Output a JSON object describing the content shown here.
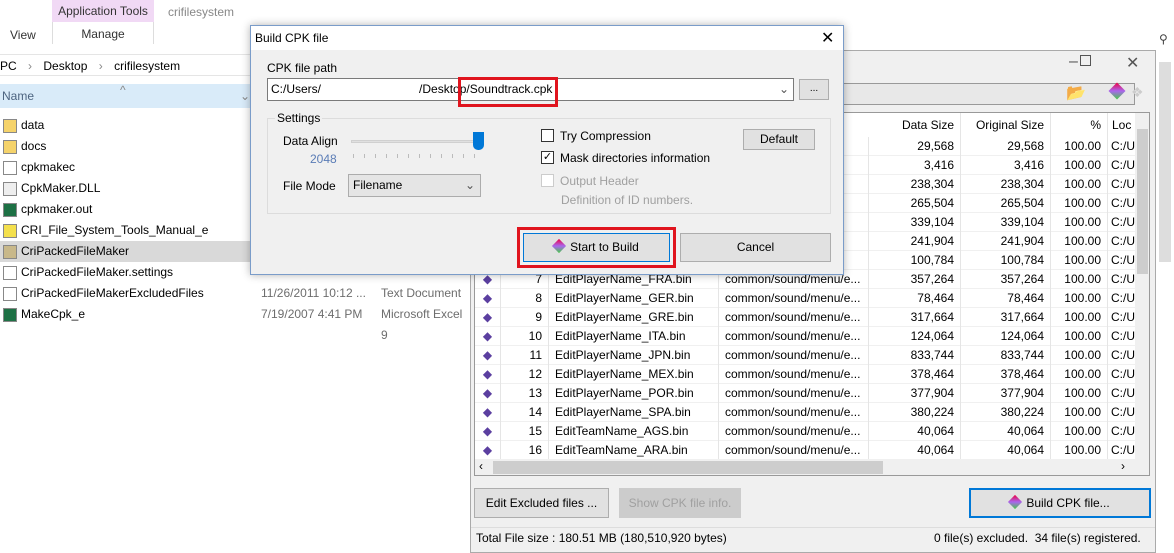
{
  "explorer": {
    "ribbon": {
      "view": "View",
      "application_tools": "Application Tools",
      "manage": "Manage",
      "title": "crifilesystem"
    },
    "breadcrumb": [
      "PC",
      "Desktop",
      "crifilesystem"
    ],
    "column_name": "Name",
    "files": [
      {
        "name": "data",
        "icon": "folder-icon",
        "date": "",
        "type": ""
      },
      {
        "name": "docs",
        "icon": "folder-icon",
        "date": "",
        "type": ""
      },
      {
        "name": "cpkmakec",
        "icon": "console-app-icon",
        "date": "",
        "type": ""
      },
      {
        "name": "CpkMaker.DLL",
        "icon": "dll-icon",
        "date": "",
        "type": ""
      },
      {
        "name": "cpkmaker.out",
        "icon": "excel-icon",
        "date": "",
        "type": ""
      },
      {
        "name": "CRI_File_System_Tools_Manual_e",
        "icon": "help-file-icon",
        "date": "",
        "type": ""
      },
      {
        "name": "CriPackedFileMaker",
        "icon": "app-icon",
        "date": "",
        "type": "",
        "selected": true
      },
      {
        "name": "CriPackedFileMaker.settings",
        "icon": "file-icon",
        "date": "",
        "type": ""
      },
      {
        "name": "CriPackedFileMakerExcludedFiles",
        "icon": "text-file-icon",
        "date": "11/26/2011 10:12 ...",
        "type": "Text Document"
      },
      {
        "name": "MakeCpk_e",
        "icon": "excel-icon",
        "date": "7/19/2007 4:41 PM",
        "type": "Microsoft Excel 9"
      }
    ]
  },
  "cpk_window": {
    "columns": [
      "Data Size",
      "Original Size",
      "%",
      "Loc"
    ],
    "rows": [
      {
        "no": "",
        "name": "",
        "path": "/...",
        "data_size": "29,568",
        "original_size": "29,568",
        "pct": "100.00",
        "loc": "C:/U"
      },
      {
        "no": "",
        "name": "",
        "path": "/p...",
        "data_size": "3,416",
        "original_size": "3,416",
        "pct": "100.00",
        "loc": "C:/U"
      },
      {
        "no": "",
        "name": "",
        "path": "/e...",
        "data_size": "238,304",
        "original_size": "238,304",
        "pct": "100.00",
        "loc": "C:/U"
      },
      {
        "no": "",
        "name": "",
        "path": "/e...",
        "data_size": "265,504",
        "original_size": "265,504",
        "pct": "100.00",
        "loc": "C:/U"
      },
      {
        "no": "",
        "name": "",
        "path": "/e...",
        "data_size": "339,104",
        "original_size": "339,104",
        "pct": "100.00",
        "loc": "C:/U"
      },
      {
        "no": "",
        "name": "",
        "path": "/e...",
        "data_size": "241,904",
        "original_size": "241,904",
        "pct": "100.00",
        "loc": "C:/U"
      },
      {
        "no": "",
        "name": "",
        "path": "/e...",
        "data_size": "100,784",
        "original_size": "100,784",
        "pct": "100.00",
        "loc": "C:/U"
      },
      {
        "no": "7",
        "name": "EditPlayerName_FRA.bin",
        "path": "common/sound/menu/e...",
        "data_size": "357,264",
        "original_size": "357,264",
        "pct": "100.00",
        "loc": "C:/U"
      },
      {
        "no": "8",
        "name": "EditPlayerName_GER.bin",
        "path": "common/sound/menu/e...",
        "data_size": "78,464",
        "original_size": "78,464",
        "pct": "100.00",
        "loc": "C:/U"
      },
      {
        "no": "9",
        "name": "EditPlayerName_GRE.bin",
        "path": "common/sound/menu/e...",
        "data_size": "317,664",
        "original_size": "317,664",
        "pct": "100.00",
        "loc": "C:/U"
      },
      {
        "no": "10",
        "name": "EditPlayerName_ITA.bin",
        "path": "common/sound/menu/e...",
        "data_size": "124,064",
        "original_size": "124,064",
        "pct": "100.00",
        "loc": "C:/U"
      },
      {
        "no": "11",
        "name": "EditPlayerName_JPN.bin",
        "path": "common/sound/menu/e...",
        "data_size": "833,744",
        "original_size": "833,744",
        "pct": "100.00",
        "loc": "C:/U"
      },
      {
        "no": "12",
        "name": "EditPlayerName_MEX.bin",
        "path": "common/sound/menu/e...",
        "data_size": "378,464",
        "original_size": "378,464",
        "pct": "100.00",
        "loc": "C:/U"
      },
      {
        "no": "13",
        "name": "EditPlayerName_POR.bin",
        "path": "common/sound/menu/e...",
        "data_size": "377,904",
        "original_size": "377,904",
        "pct": "100.00",
        "loc": "C:/U"
      },
      {
        "no": "14",
        "name": "EditPlayerName_SPA.bin",
        "path": "common/sound/menu/e...",
        "data_size": "380,224",
        "original_size": "380,224",
        "pct": "100.00",
        "loc": "C:/U"
      },
      {
        "no": "15",
        "name": "EditTeamName_AGS.bin",
        "path": "common/sound/menu/e...",
        "data_size": "40,064",
        "original_size": "40,064",
        "pct": "100.00",
        "loc": "C:/U"
      },
      {
        "no": "16",
        "name": "EditTeamName_ARA.bin",
        "path": "common/sound/menu/e...",
        "data_size": "40,064",
        "original_size": "40,064",
        "pct": "100.00",
        "loc": "C:/U"
      }
    ],
    "buttons": {
      "edit_excluded": "Edit Excluded files ...",
      "show_info": "Show CPK file info.",
      "build": "Build CPK file..."
    },
    "status": {
      "total": "Total File size : 180.51 MB (180,510,920 bytes)",
      "counts": "0 file(s) excluded.  34 file(s) registered."
    }
  },
  "dialog": {
    "title": "Build CPK file",
    "path_label": "CPK file path",
    "path_prefix": "C:/Users/",
    "path_mid": "/Deskto",
    "path_highlight": "p/Soundtrack.cpk",
    "browse": "...",
    "settings": "Settings",
    "data_align_label": "Data Align",
    "data_align_value": "2048",
    "slider_fraction": 1.0,
    "file_mode_label": "File Mode",
    "file_mode": "Filename",
    "try_compression": {
      "label": "Try Compression",
      "checked": false
    },
    "mask_dirs": {
      "label": "Mask directories information",
      "checked": true
    },
    "output_header": {
      "label": "Output Header",
      "checked": false,
      "disabled": true
    },
    "definition_note": "Definition of ID numbers.",
    "default": "Default",
    "start": "Start to Build",
    "cancel": "Cancel"
  },
  "colors": {
    "highlight": "#e0141e",
    "accent": "#0078d7",
    "app_tools_tab": "#f1d9f5"
  }
}
